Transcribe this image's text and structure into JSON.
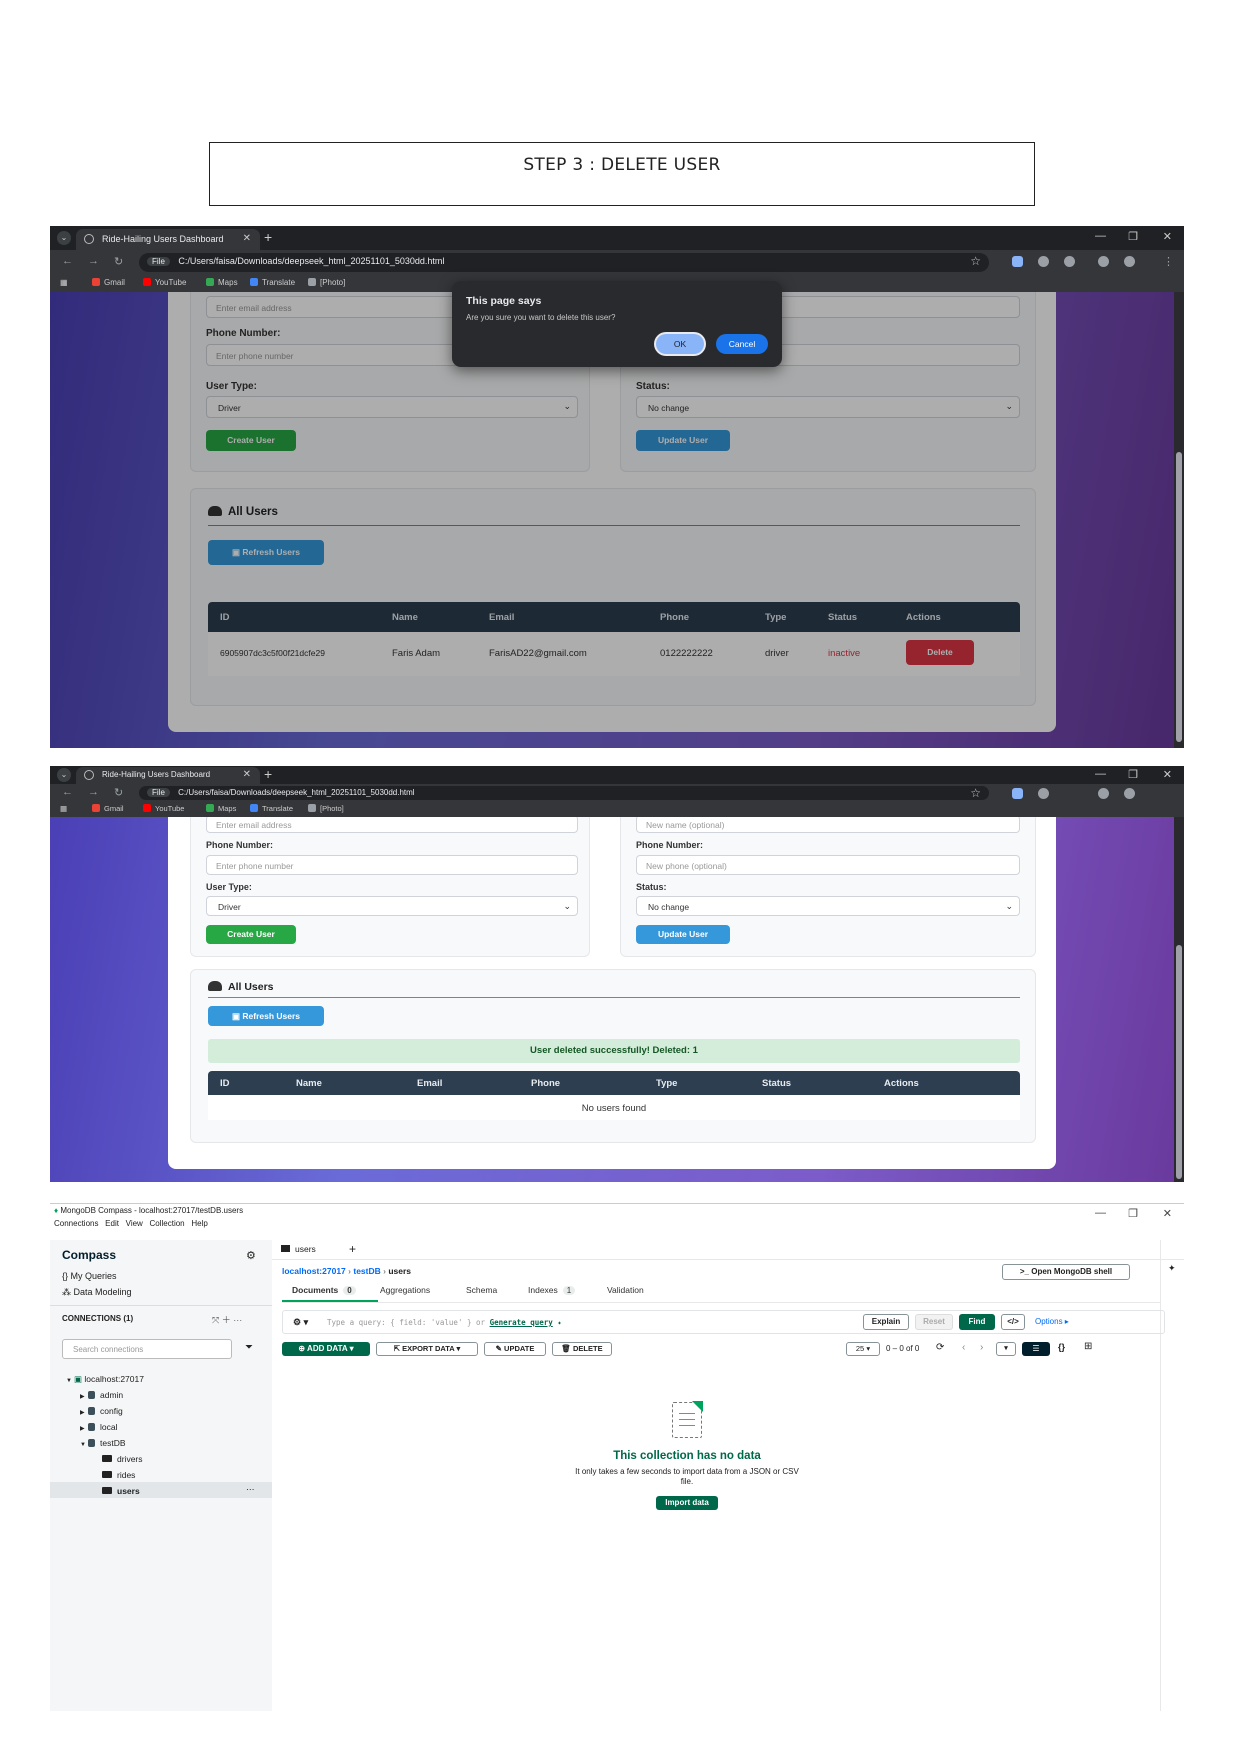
{
  "step": {
    "title": "STEP 3 : DELETE USER"
  },
  "browser": {
    "tab_title": "Ride-Hailing Users Dashboard",
    "file_badge": "File",
    "url": "C:/Users/faisa/Downloads/deepseek_html_20251101_5030dd.html",
    "bookmarks": [
      "Gmail",
      "YouTube",
      "Maps",
      "Translate",
      "[Photo]"
    ]
  },
  "form": {
    "email_placeholder": "Enter email address",
    "phone_label": "Phone Number:",
    "phone_placeholder": "Enter phone number",
    "user_type_label": "User Type:",
    "user_type_value": "Driver",
    "create_button": "Create User",
    "update_name_placeholder": "New name (optional)",
    "update_phone_label": "Phone Number:",
    "update_phone_placeholder": "New phone (optional)",
    "status_label": "Status:",
    "status_value": "No change",
    "update_button": "Update User"
  },
  "users_section": {
    "title": "All Users",
    "refresh_button": "Refresh Users",
    "columns": [
      "ID",
      "Name",
      "Email",
      "Phone",
      "Type",
      "Status",
      "Actions"
    ],
    "row": {
      "id": "6905907dc3c5f00f21dcfe29",
      "name": "Faris Adam",
      "email": "FarisAD22@gmail.com",
      "phone": "0122222222",
      "type": "driver",
      "status": "inactive",
      "action": "Delete"
    },
    "success_message": "User deleted successfully! Deleted: 1",
    "empty_message": "No users found"
  },
  "dialog": {
    "title": "This page says",
    "message": "Are you sure you want to delete this user?",
    "ok": "OK",
    "cancel": "Cancel"
  },
  "compass": {
    "window_title": "MongoDB Compass - localhost:27017/testDB.users",
    "menu": [
      "Connections",
      "Edit",
      "View",
      "Collection",
      "Help"
    ],
    "brand": "Compass",
    "my_queries": "My Queries",
    "data_modeling": "Data Modeling",
    "connections_header": "CONNECTIONS (1)",
    "search_placeholder": "Search connections",
    "tree": {
      "host": "localhost:27017",
      "databases": [
        "admin",
        "config",
        "local",
        "testDB"
      ],
      "collections": [
        "drivers",
        "rides",
        "users"
      ]
    },
    "tab": "users",
    "breadcrumb": {
      "host": "localhost:27017",
      "db": "testDB",
      "coll": "users"
    },
    "open_shell": ">_ Open MongoDB shell",
    "subtabs": [
      {
        "label": "Documents",
        "count": "0"
      },
      {
        "label": "Aggregations"
      },
      {
        "label": "Schema"
      },
      {
        "label": "Indexes",
        "count": "1"
      },
      {
        "label": "Validation"
      }
    ],
    "query_placeholder": "Type a query: { field: 'value' } or",
    "generate_query": "Generate query",
    "explain": "Explain",
    "reset": "Reset",
    "find": "Find",
    "options": "Options ▸",
    "add_data": "ADD DATA",
    "export_data": "EXPORT DATA",
    "update": "UPDATE",
    "delete": "DELETE",
    "page_size": "25",
    "range": "0 – 0 of 0",
    "empty_title": "This collection has no data",
    "empty_desc_1": "It only takes a few seconds to import data from a JSON or CSV",
    "empty_desc_2": "file.",
    "import_button": "Import data"
  }
}
